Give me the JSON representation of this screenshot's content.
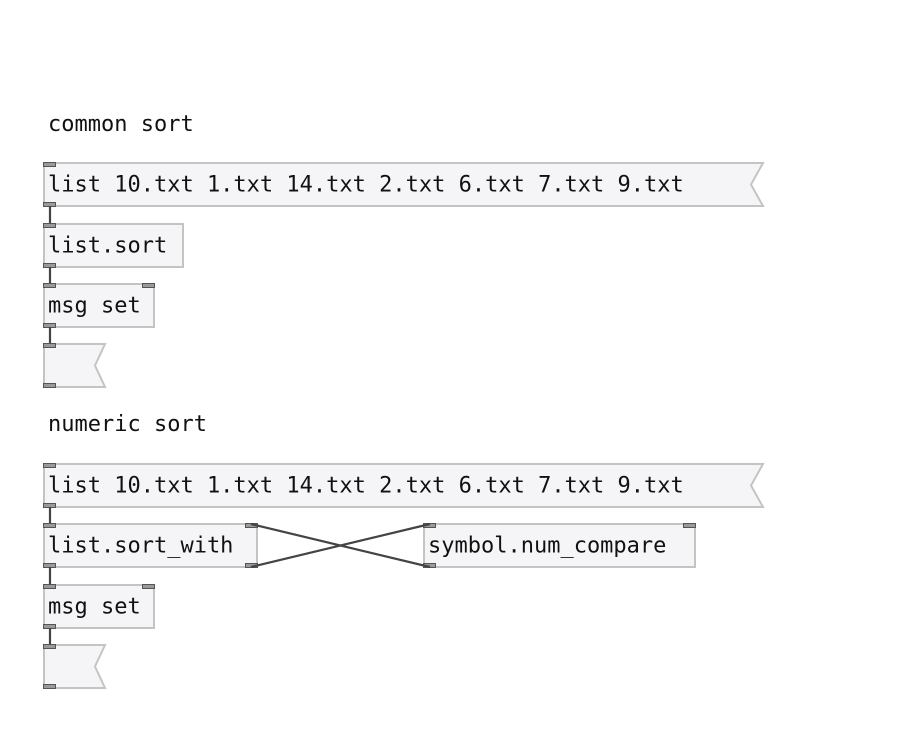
{
  "sections": [
    {
      "heading": "common sort",
      "list_message": "list 10.txt 1.txt 14.txt 2.txt 6.txt 7.txt 9.txt",
      "sort_object": "list.sort",
      "set_message": "msg set",
      "output_message": ""
    },
    {
      "heading": "numeric sort",
      "list_message": "list 10.txt 1.txt 14.txt 2.txt 6.txt 7.txt 9.txt",
      "sort_object": "list.sort_with",
      "compare_object": "symbol.num_compare",
      "set_message": "msg set",
      "output_message": ""
    }
  ],
  "colors": {
    "box_fill": "#f5f5f7",
    "box_border": "#c4c4c4",
    "cord": "#444444",
    "text": "#111111"
  }
}
